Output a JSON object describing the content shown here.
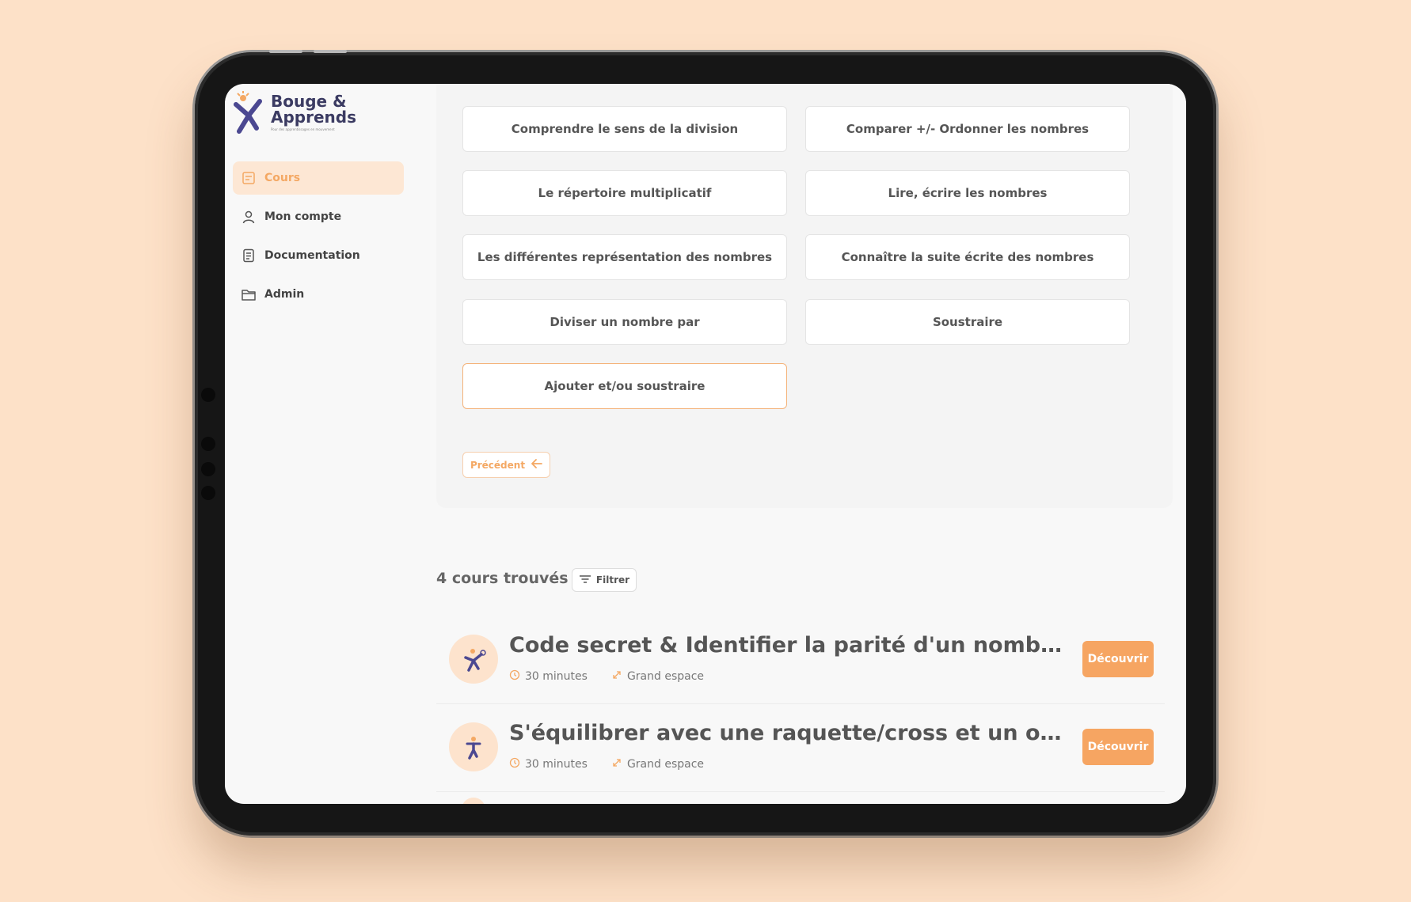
{
  "brand": {
    "name_line1": "Bouge &",
    "name_line2": "Apprends",
    "tagline": "Pour des apprentissages en mouvement"
  },
  "sidebar": {
    "items": [
      {
        "label": "Cours",
        "icon": "course-icon",
        "active": true
      },
      {
        "label": "Mon compte",
        "icon": "user-icon",
        "active": false
      },
      {
        "label": "Documentation",
        "icon": "document-icon",
        "active": false
      },
      {
        "label": "Admin",
        "icon": "folder-icon",
        "active": false
      }
    ]
  },
  "topics": [
    "Comprendre le sens de la division",
    "Comparer +/- Ordonner les nombres",
    "Le répertoire multiplicatif",
    "Lire, écrire les nombres",
    "Les différentes représentation des nombres",
    "Connaître la suite écrite des nombres",
    "Diviser un nombre par",
    "Soustraire",
    "Ajouter et/ou soustraire"
  ],
  "selected_topic_index": 8,
  "previous_label": "Précédent",
  "results": {
    "count_label": "4 cours trouvés",
    "filter_label": "Filtrer",
    "items": [
      {
        "title": "Code secret & Identifier la parité d'un nombre (paire/i...",
        "duration": "30 minutes",
        "space": "Grand espace",
        "cta": "Découvrir"
      },
      {
        "title": "S'équilibrer avec une raquette/cross et un objet & Ide...",
        "duration": "30 minutes",
        "space": "Grand espace",
        "cta": "Découvrir"
      }
    ]
  },
  "colors": {
    "accent": "#f6a562",
    "background": "#fde1c8",
    "text": "#555555"
  }
}
